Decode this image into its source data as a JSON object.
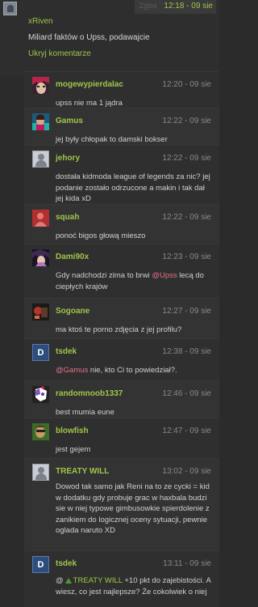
{
  "top": {
    "report": "Zgłoś",
    "time": "12:18 - 09 sie",
    "user": "xRiven",
    "text": "Miliard faktów o Upss, podawajcie",
    "hide_comments": "Ukryj komentarze"
  },
  "replies": [
    {
      "user": "mogewypierdalac",
      "time": "12:20 - 09 sie",
      "text": "upss nie ma 1 jądra",
      "avatar": "anime-avatar",
      "colors": [
        "#b8244a",
        "#e1c1a4",
        "#3a2130"
      ]
    },
    {
      "user": "Gamus",
      "time": "12:22 - 09 sie",
      "text": "jej były chłopak to damski bokser",
      "avatar": "photo-avatar",
      "colors": [
        "#c2185b",
        "#23b0a6",
        "#1a5c7e"
      ]
    },
    {
      "user": "jehory",
      "time": "12:22 - 09 sie",
      "text": "dostała kidmoda league of legends za nic? jej podanie zostało odrzucone a makin i tak dał jej kida xD",
      "avatar": "default-avatar"
    },
    {
      "user": "squah",
      "time": "12:22 - 09 sie",
      "text": "ponoć bigos głową mieszo",
      "avatar": "silhouette-avatar",
      "colors": [
        "#cc3b3b",
        "#8a1f1f",
        "#e27878"
      ]
    },
    {
      "user": "Dami90x",
      "time": "12:23 - 09 sie",
      "text_pre": "Gdy nadchodzi zima to brwi ",
      "mention": "@Upss",
      "text_post": " lecą do ciepłych krajów",
      "avatar": "anime-avatar",
      "colors": [
        "#3f2a55",
        "#b17ab6",
        "#1b1425"
      ]
    },
    {
      "user": "Sogoane",
      "time": "12:27 - 09 sie",
      "text": "ma ktoś te porno zdjęcia z jej profilu?",
      "avatar": "photo-avatar",
      "colors": [
        "#1a1a1a",
        "#b7332a",
        "#5a3a2a"
      ]
    },
    {
      "user": "tsdek",
      "time": "12:38 - 09 sie",
      "text_pre": "",
      "mention": "@Gamus",
      "text_post": " nie, kto Ci to powiedział?.",
      "avatar": "letter-avatar",
      "letter": "D"
    },
    {
      "user": "randomnoob1337",
      "time": "12:46 - 09 sie",
      "text": "best mumia eune",
      "avatar": "pony-avatar",
      "colors": [
        "#ffffff",
        "#7e57c2",
        "#e91e63"
      ]
    },
    {
      "user": "blowfish",
      "time": "12:47 - 09 sie",
      "text": "jest gejem",
      "avatar": "photo-avatar",
      "colors": [
        "#3d6b2a",
        "#c59a63",
        "#222"
      ]
    },
    {
      "user": "TREATY WILL",
      "time": "13:02 - 09 sie",
      "text": "Dowod tak samo jak Reni na to ze cycki = kid w dodatku gdy probuje grac w haxbala budzi sie w niej typowe gimbusowkie spierdolenie z zanikiem do logicznej oceny sytuacji, pewnie oglada naruto XD",
      "avatar": "default-avatar"
    },
    {
      "user": "tsdek",
      "time": "13:11 - 09 sie",
      "text_pre": "@",
      "mention_green": "TREATY WILL",
      "text_post": " +10 pkt do zajebistości. A wiesz, co jest najlepsze? Że cokolwiek o niej",
      "avatar": "letter-avatar",
      "letter": "D"
    }
  ]
}
